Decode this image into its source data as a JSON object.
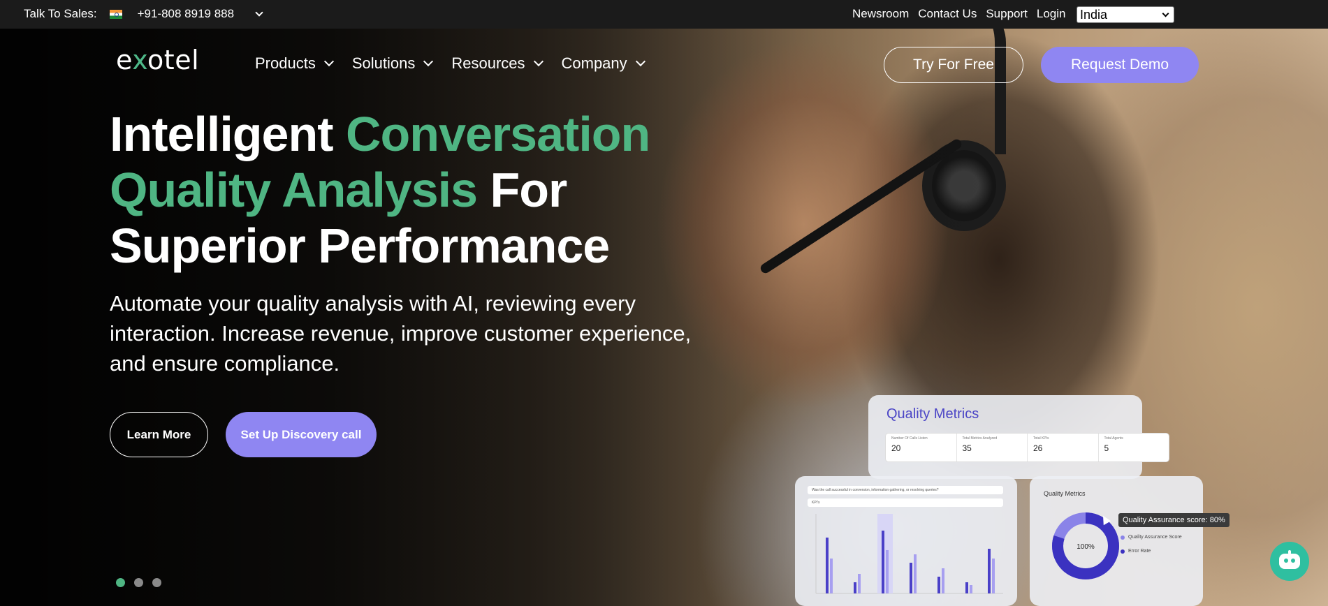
{
  "topbar": {
    "sales_label": "Talk To Sales:",
    "phone": "+91-808 8919 888",
    "links": [
      "Newsroom",
      "Contact Us",
      "Support",
      "Login"
    ],
    "country": "India"
  },
  "brand": {
    "logo_pre": "e",
    "logo_x": "x",
    "logo_post": "otel"
  },
  "nav": {
    "items": [
      "Products",
      "Solutions",
      "Resources",
      "Company"
    ],
    "try_free": "Try For Free",
    "request_demo": "Request Demo"
  },
  "hero": {
    "line1_white": "Intelligent ",
    "line1_green": "Conversation",
    "line2_green": "Quality Analysis",
    "line2_white": " For",
    "line3_white": "Superior Performance",
    "subtitle": "Automate your quality analysis with AI, reviewing every interaction. Increase revenue, improve customer experience, and ensure compliance.",
    "learn_more": "Learn More",
    "discovery": "Set Up Discovery call"
  },
  "slider": {
    "count": 3,
    "active": 0
  },
  "dashboard": {
    "card_title": "Quality Metrics",
    "metrics": [
      {
        "label": "Number Of Calls Listen",
        "value": "20"
      },
      {
        "label": "Total Metrics Analyzed",
        "value": "35"
      },
      {
        "label": "Total KPIs",
        "value": "26"
      },
      {
        "label": "Total Agents",
        "value": "5"
      }
    ],
    "question": "Was the call successful in conversion, information gathering, or resolving queries?",
    "filter": "KPI's",
    "donut_title": "Quality Metrics",
    "donut_center": "100%",
    "legend": [
      "Quality Assurance Score",
      "Error Rate"
    ],
    "tooltip": "Quality Assurance score: 80%",
    "donut_share": 0.8
  },
  "colors": {
    "green": "#4fb583",
    "purple": "#8f86f2",
    "chatbot": "#2fbfa0"
  },
  "icons": {
    "chatbot": "robot-icon",
    "flag": "india-flag-icon"
  }
}
